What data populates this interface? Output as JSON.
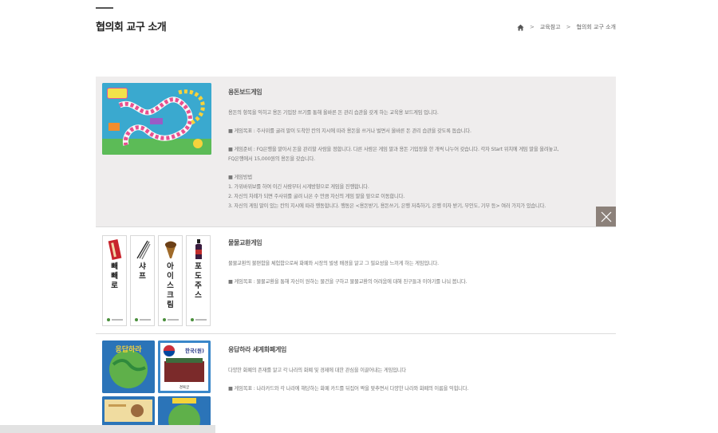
{
  "page": {
    "title": "협의회 교구 소개"
  },
  "breadcrumb": {
    "home_icon": "home-icon",
    "separator": ">",
    "items": [
      "교육참고",
      "협의회 교구 소개"
    ]
  },
  "items": [
    {
      "title": "용돈보드게임",
      "paragraphs": [
        [
          "용돈의 항목을 익히고 용돈 기입장 쓰기를 통해 올바른 돈 관리 습관을 갖게 하는 교육용 보드게임 입니다."
        ],
        [
          "■ 게임목표 : 주사위를 굴려 말이 도착한 칸의 지시에 따라 용돈을 쓰거나 벌면서 올바른 돈 관리 습관을 갖도록 돕습니다."
        ],
        [
          "■ 게임준비 : FQ은행을 맡아서 돈을 관리할 사람을 정합니다. 다른 사람은 게임 말과 용돈 기입장을 한 개씩 나누어 갖습니다. 각자 Start 위치에 게임 말을 올려놓고,",
          "FQ은행에서 15,000원의 용돈을 갖습니다."
        ],
        [
          "■ 게임방법",
          "1. 가위바위보를 하여 이긴 사람부터 시계방향으로 게임을 진행합니다.",
          "2. 자신의 차례가 되면 주사위를 굴려 나온 수 만큼 자신의 게임 말을 앞으로 이동합니다.",
          "3. 자신의 게임 말이 있는 칸의 지시에 따라 행동합니다. 행동은 <용돈받기, 용돈쓰기, 은행 저축하기, 은행 이자 받기, 무인도, 기부 등> 여러 가지가 있습니다."
        ]
      ],
      "close_icon": "close-icon"
    },
    {
      "title": "물물교환게임",
      "paragraphs": [
        [
          "물물교환의 불편함을 체험함으로써 화폐와 시장의 발생 배경을 알고 그 필요성을 느끼게 하는 게임입니다."
        ],
        [
          "■ 게임목표 : 물물교환을 통해 자신이 원하는 물건을 구하고 물물교환의 어려움에 대해 친구들과 이야기를 나눠 봅니다."
        ]
      ],
      "cards": [
        "빼빼로",
        "샤프",
        "아이스크림",
        "포도주스"
      ]
    },
    {
      "title": "응답하라 세계화폐게임",
      "paragraphs": [
        [
          "다양한 화폐의 존재를 알고 각 나라의 화폐 및 경제에 대한 관심을 이끌어내는 게임입니다"
        ],
        [
          "■ 게임목표 : 나라카드와 각 나라에 해당하는 화폐 카드를 뒤집어 짝을 맞추면서 다양한 나라와 화폐의 이름을 익힙니다."
        ]
      ],
      "thumb_texts": {
        "logo": "응답하라",
        "country": "한국(원)",
        "place": "경복궁"
      }
    }
  ],
  "colors": {
    "active_bg": "#efeded",
    "close_bg": "#8c817a",
    "board_bg": "#3aa9cf",
    "currency_bg": "#2b74b8"
  }
}
